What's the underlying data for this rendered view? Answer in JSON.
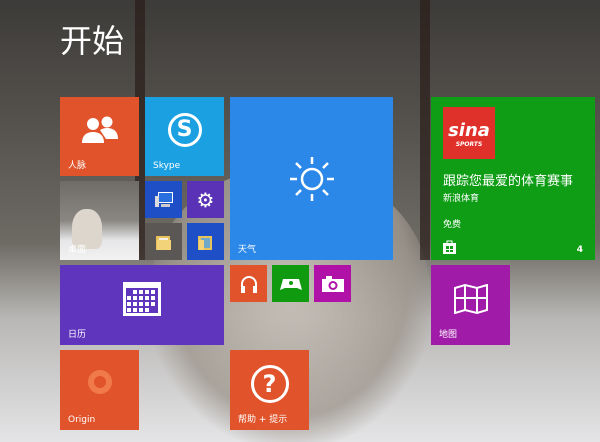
{
  "header": {
    "title": "开始"
  },
  "tiles": {
    "people": {
      "label": "人脉",
      "color": "#e0532b",
      "icon": "people-icon"
    },
    "skype": {
      "label": "Skype",
      "color": "#1ba1e2",
      "icon": "skype-icon",
      "glyph": "S"
    },
    "weather": {
      "label": "天气",
      "color": "#2b88e8",
      "icon": "sun-icon"
    },
    "sina": {
      "headline": "跟踪您最爱的体育赛事",
      "app": "新浪体育",
      "price": "免费",
      "count": "4",
      "logo_text": "sina",
      "logo_sub": "SPORTS",
      "color": "#0f9d16",
      "icon": "store-icon"
    },
    "desktop": {
      "label": "桌面",
      "icon": "desktop-photo"
    },
    "this_pc": {
      "color": "#1e4fc7",
      "icon": "computer-icon"
    },
    "pc_settings": {
      "color": "#5a32b5",
      "icon": "gear-icon"
    },
    "file_explorer": {
      "color": "#5b5754",
      "icon": "folder-icon"
    },
    "photos_folder": {
      "color": "#1e4fc7",
      "icon": "folder-icon"
    },
    "calendar": {
      "label": "日历",
      "color": "#6035bd",
      "icon": "calendar-icon"
    },
    "music": {
      "color": "#e0532b",
      "icon": "headphones-icon"
    },
    "games": {
      "color": "#109a10",
      "icon": "gamepad-icon"
    },
    "camera": {
      "color": "#b012a8",
      "icon": "camera-icon"
    },
    "maps": {
      "label": "地图",
      "color": "#a01ca8",
      "icon": "map-icon"
    },
    "origin": {
      "label": "Origin",
      "color": "#e0532b",
      "icon": "origin-icon"
    },
    "help": {
      "label": "帮助 + 提示",
      "color": "#e0532b",
      "icon": "help-icon",
      "glyph": "?"
    }
  }
}
